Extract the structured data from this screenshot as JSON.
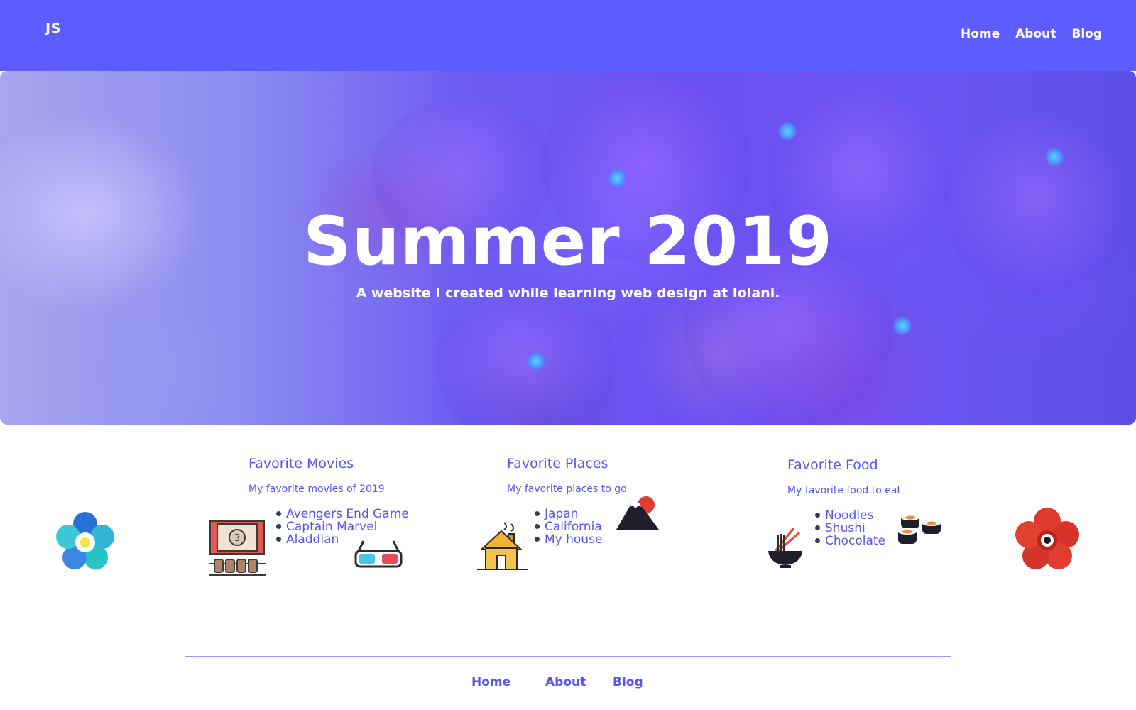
{
  "header": {
    "logo": "JS",
    "nav": [
      "Home",
      "About",
      "Blog"
    ]
  },
  "hero": {
    "title": "Summer 2019",
    "subtitle": "A website I created while learning web design at Iolani."
  },
  "sections": [
    {
      "title": "Favorite Movies",
      "subtitle": "My favorite movies of 2019",
      "items": [
        "Avengers End Game",
        "Captain Marvel",
        "Aladdian"
      ],
      "icons": [
        "movie-theater-icon",
        "3d-glasses-icon"
      ]
    },
    {
      "title": "Favorite Places",
      "subtitle": "My favorite places to go",
      "items": [
        "Japan",
        "California",
        "My house"
      ],
      "icons": [
        "house-icon",
        "mount-fuji-icon"
      ]
    },
    {
      "title": "Favorite Food",
      "subtitle": "My favorite food to eat",
      "items": [
        "Noodles",
        "Shushi",
        "Chocolate"
      ],
      "icons": [
        "noodle-bowl-icon",
        "sushi-icon"
      ]
    }
  ],
  "side_icons": [
    "blue-flower-icon",
    "red-flower-icon"
  ],
  "footer": {
    "nav": [
      "Home",
      "About",
      "Blog"
    ]
  },
  "colors": {
    "primary": "#5c5cff",
    "text_accent": "#5555ee",
    "footer_rule": "#9a9aff"
  }
}
